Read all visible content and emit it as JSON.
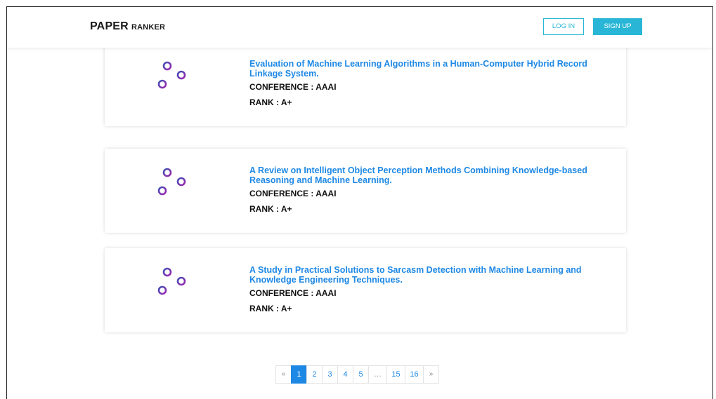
{
  "navbar": {
    "brand_main": "PAPER",
    "brand_sub": "RANKER",
    "login_label": "LOG IN",
    "signup_label": "SIGN UP"
  },
  "colors": {
    "accent": "#29b6d6",
    "link": "#1e88e5",
    "icon_gradient_start": "#3f51b5",
    "icon_gradient_end": "#9c27b0"
  },
  "papers": [
    {
      "icon": "sliders-icon",
      "title": "Evaluation of Machine Learning Algorithms in a Human-Computer Hybrid Record Linkage System.",
      "conference": "CONFERENCE : AAAI",
      "rank": "RANK : A+"
    },
    {
      "icon": "sliders-icon",
      "title": "A Review on Intelligent Object Perception Methods Combining Knowledge-based Reasoning and Machine Learning.",
      "conference": "CONFERENCE : AAAI",
      "rank": "RANK : A+"
    },
    {
      "icon": "sliders-icon",
      "title": "A Study in Practical Solutions to Sarcasm Detection with Machine Learning and Knowledge Engineering Techniques.",
      "conference": "CONFERENCE : AAAI",
      "rank": "RANK : A+"
    }
  ],
  "pagination": {
    "prev": "«",
    "pages": [
      "1",
      "2",
      "3",
      "4",
      "5",
      "…",
      "15",
      "16"
    ],
    "next": "»",
    "current": "1"
  }
}
